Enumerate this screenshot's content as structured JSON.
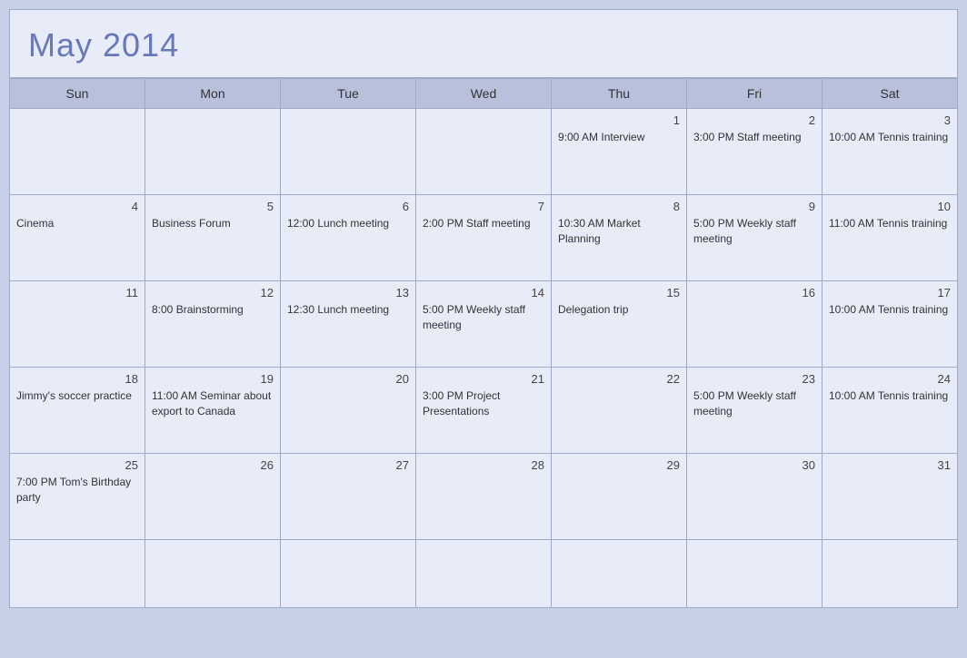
{
  "header": {
    "title": "May 2014"
  },
  "weekdays": [
    "Sun",
    "Mon",
    "Tue",
    "Wed",
    "Thu",
    "Fri",
    "Sat"
  ],
  "weeks": [
    [
      {
        "day": "",
        "event": ""
      },
      {
        "day": "",
        "event": ""
      },
      {
        "day": "",
        "event": ""
      },
      {
        "day": "",
        "event": ""
      },
      {
        "day": "1",
        "event": "9:00 AM Interview"
      },
      {
        "day": "2",
        "event": "3:00 PM Staff meeting"
      },
      {
        "day": "3",
        "event": "10:00 AM Tennis training"
      }
    ],
    [
      {
        "day": "4",
        "event": "Cinema"
      },
      {
        "day": "5",
        "event": "Business Forum"
      },
      {
        "day": "6",
        "event": "12:00 Lunch meeting"
      },
      {
        "day": "7",
        "event": "2:00 PM Staff meeting"
      },
      {
        "day": "8",
        "event": "10:30 AM Market Planning"
      },
      {
        "day": "9",
        "event": "5:00 PM Weekly staff meeting"
      },
      {
        "day": "10",
        "event": "11:00 AM Tennis training"
      }
    ],
    [
      {
        "day": "11",
        "event": ""
      },
      {
        "day": "12",
        "event": "8:00 Brainstorming"
      },
      {
        "day": "13",
        "event": "12:30 Lunch meeting"
      },
      {
        "day": "14",
        "event": "5:00 PM Weekly staff meeting"
      },
      {
        "day": "15",
        "event": "Delegation trip"
      },
      {
        "day": "16",
        "event": ""
      },
      {
        "day": "17",
        "event": "10:00 AM Tennis training"
      }
    ],
    [
      {
        "day": "18",
        "event": "Jimmy's soccer practice"
      },
      {
        "day": "19",
        "event": "11:00 AM Seminar about export to Canada"
      },
      {
        "day": "20",
        "event": ""
      },
      {
        "day": "21",
        "event": "3:00 PM Project Presentations"
      },
      {
        "day": "22",
        "event": ""
      },
      {
        "day": "23",
        "event": "5:00 PM Weekly staff meeting"
      },
      {
        "day": "24",
        "event": "10:00 AM Tennis training"
      }
    ],
    [
      {
        "day": "25",
        "event": "7:00 PM Tom's Birthday party"
      },
      {
        "day": "26",
        "event": ""
      },
      {
        "day": "27",
        "event": ""
      },
      {
        "day": "28",
        "event": ""
      },
      {
        "day": "29",
        "event": ""
      },
      {
        "day": "30",
        "event": ""
      },
      {
        "day": "31",
        "event": ""
      }
    ],
    [
      {
        "day": "",
        "event": ""
      },
      {
        "day": "",
        "event": ""
      },
      {
        "day": "",
        "event": ""
      },
      {
        "day": "",
        "event": ""
      },
      {
        "day": "",
        "event": ""
      },
      {
        "day": "",
        "event": ""
      },
      {
        "day": "",
        "event": ""
      }
    ]
  ]
}
